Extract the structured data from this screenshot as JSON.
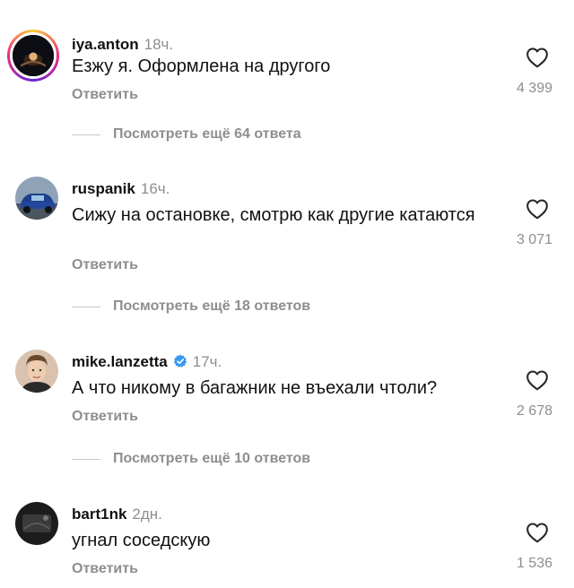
{
  "comments": [
    {
      "username": "iya.anton",
      "time": "18ч.",
      "text": "Езжу я. Оформлена на другого",
      "reply_label": "Ответить",
      "likes": "4 399",
      "avatar": "story-ring-avatar",
      "more_replies": "Посмотреть ещё 64 ответа"
    },
    {
      "username": "ruspanik",
      "time": "16ч.",
      "text": "Сижу на остановке, смотрю как другие катаются",
      "reply_label": "Ответить",
      "likes": "3 071",
      "avatar": "car-avatar",
      "more_replies": "Посмотреть ещё 18 ответов"
    },
    {
      "username": "mike.lanzetta",
      "time": "17ч.",
      "verified": true,
      "text": "А что никому в багажник не въехали чтоли?",
      "reply_label": "Ответить",
      "likes": "2 678",
      "avatar": "person-avatar",
      "more_replies": "Посмотреть ещё 10 ответов"
    },
    {
      "username": "bart1nk",
      "time": "2дн.",
      "text": "угнал соседскую",
      "reply_label": "Ответить",
      "likes": "1 536",
      "avatar": "dark-avatar"
    }
  ],
  "colors": {
    "text": "#111111",
    "muted": "#8e8e8e",
    "verified": "#3897f0",
    "divider": "#c7c7c7"
  },
  "icons": {
    "like": "heart-outline-icon",
    "verified": "verified-badge-icon"
  }
}
